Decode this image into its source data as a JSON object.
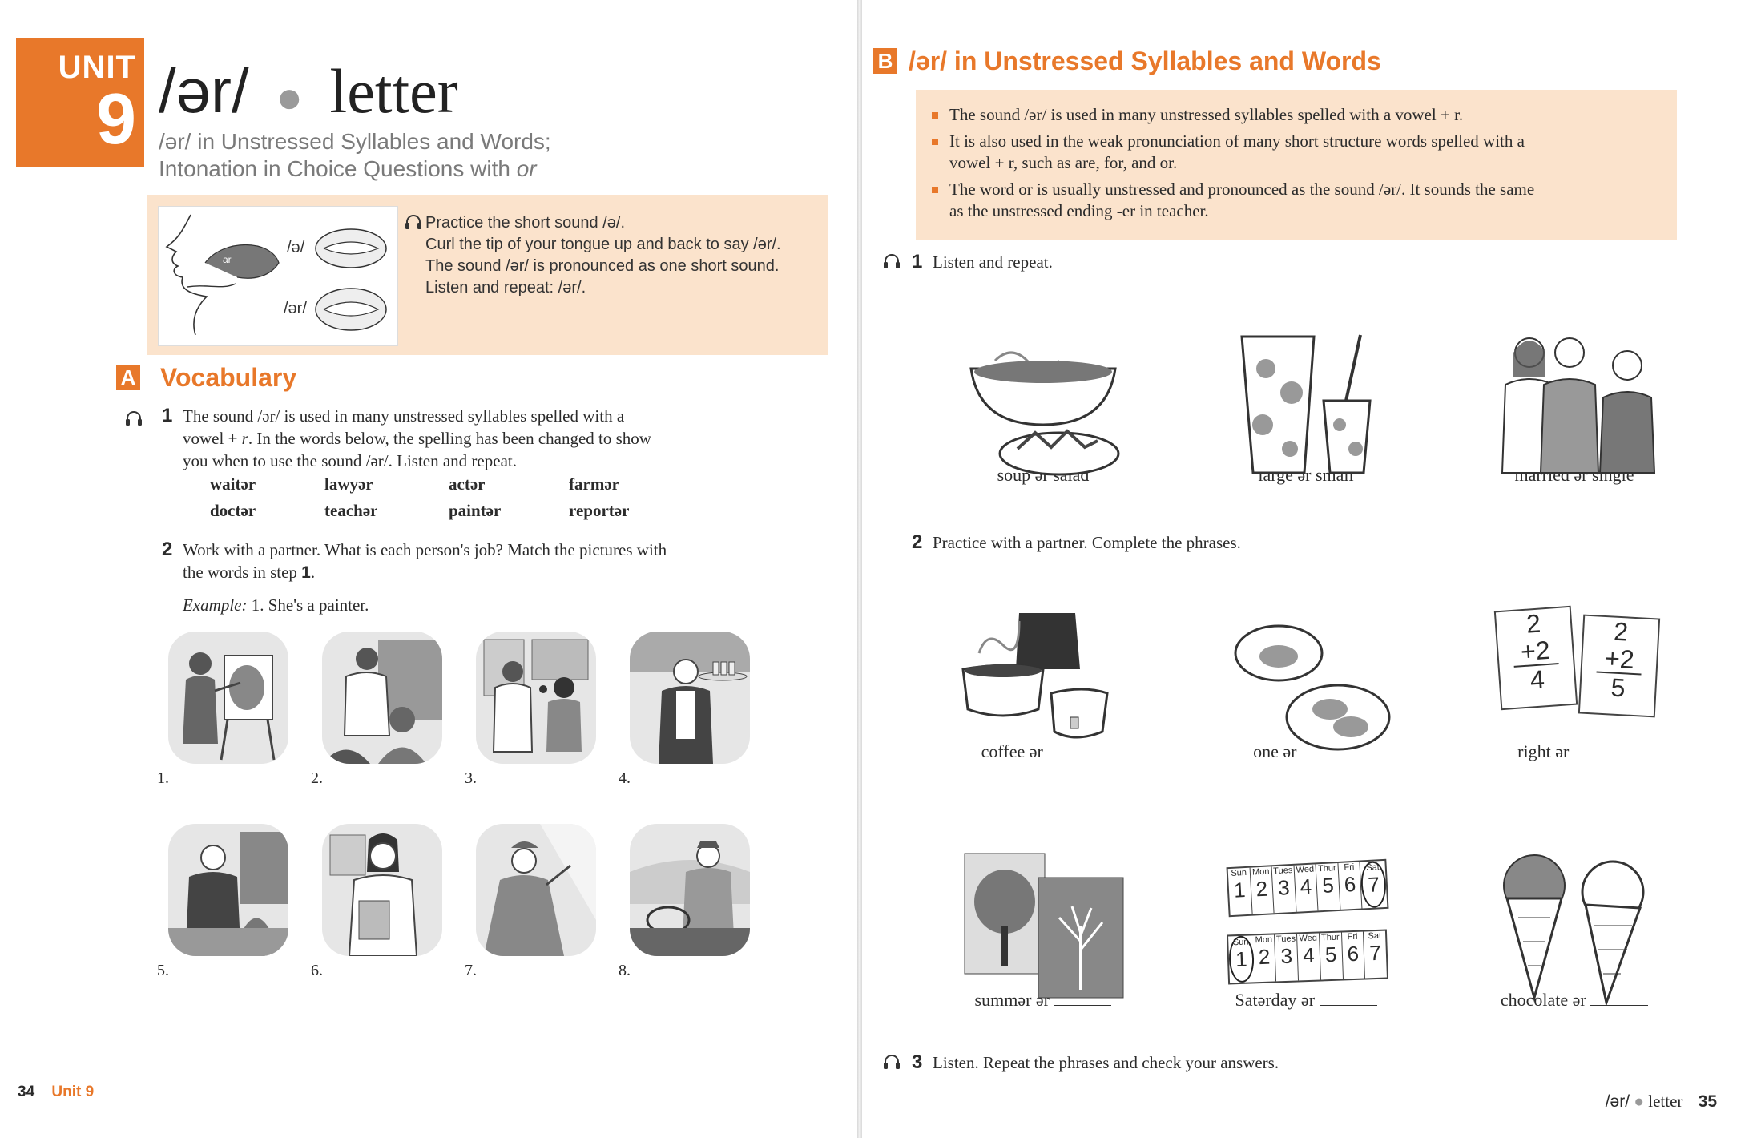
{
  "left_page": {
    "unit_word": "UNIT",
    "unit_number": "9",
    "title_sound": "/ər/",
    "title_word": "letter",
    "subtitle_line1": "/ər/ in Unstressed Syllables and Words;",
    "subtitle_line2_prefix": "Intonation in Choice Questions with ",
    "subtitle_line2_italic": "or",
    "mouth_labels": [
      "/ə/",
      "/ər/"
    ],
    "mouth_tongue_label": "ar",
    "intro_lines": [
      "Practice the short sound /ə/.",
      "Curl the tip of your tongue up and back to say /ər/.",
      "The sound /ər/ is pronounced as one short sound.",
      "Listen and repeat: /ər/."
    ],
    "section_A_letter": "A",
    "section_A_title": "Vocabulary",
    "step1_number": "1",
    "step1_line1": "The sound /ər/ is used in many unstressed syllables spelled with a",
    "step1_line2_prefix": "vowel + ",
    "step1_line2_italic": "r",
    "step1_line2_suffix": ". In the words below, the spelling has been changed to show",
    "step1_line3": "you when to use the sound /ər/. Listen and repeat.",
    "words": [
      "waitər",
      "lawyər",
      "actər",
      "farmər",
      "doctər",
      "teachər",
      "paintər",
      "reportər"
    ],
    "step2_number": "2",
    "step2_line1": "Work with a partner. What is each person's job? Match the pictures with",
    "step2_line2_prefix": "the words in step ",
    "step2_line2_num": "1",
    "step2_line2_suffix": ".",
    "example_label": "Example:",
    "example_text": "1. She's a painter.",
    "job_numbers": [
      "1.",
      "2.",
      "3.",
      "4.",
      "5.",
      "6.",
      "7.",
      "8."
    ],
    "footer_page": "34",
    "footer_unit": "Unit 9"
  },
  "right_page": {
    "section_B_letter": "B",
    "section_B_title": "/ər/ in Unstressed Syllables and Words",
    "rule1": "The sound /ər/ is used in many unstressed syllables spelled with a vowel + r.",
    "rule2_a": "It is also used in the weak pronunciation of many short structure words spelled with a",
    "rule2_b": "vowel + r, such as are, for, and or.",
    "rule3_a": "The word or is usually unstressed and pronounced as the sound /ər/. It sounds the same",
    "rule3_b": "as the unstressed ending -er in teacher.",
    "step1_number": "1",
    "step1_text": "Listen and repeat.",
    "row1_captions": [
      "soup ər salad",
      "large ər small",
      "married ər single"
    ],
    "step2_number": "2",
    "step2_text": "Practice with a partner. Complete the phrases.",
    "row2_captions": [
      "coffee ər",
      "one ər",
      "right ər"
    ],
    "row3_captions": [
      "summər ər",
      "Satərday ər",
      "chocolate ər"
    ],
    "math_card1": [
      "2",
      "+2",
      "4"
    ],
    "math_card2": [
      "2",
      "+2",
      "5"
    ],
    "calendar_days": [
      "Sun",
      "Mon",
      "Tues",
      "Wed",
      "Thur",
      "Fri",
      "Sat"
    ],
    "calendar_nums": [
      "1",
      "2",
      "3",
      "4",
      "5",
      "6",
      "7"
    ],
    "step3_number": "3",
    "step3_text": "Listen. Repeat the phrases and check your answers.",
    "footer_sound": "/ər/",
    "footer_word": "letter",
    "footer_page": "35"
  },
  "colors": {
    "accent": "#e8782a",
    "tint": "#fbe3cc",
    "subtitle_gray": "#7a7a7a"
  }
}
